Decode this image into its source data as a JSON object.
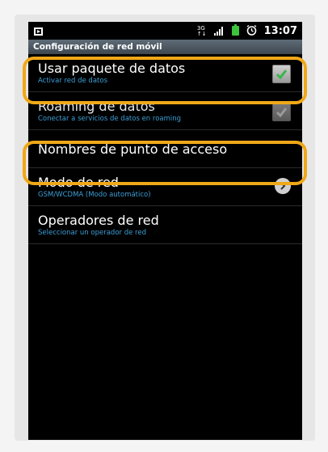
{
  "statusbar": {
    "time": "13:07",
    "network": "3G"
  },
  "title": "Configuración de red móvil",
  "items": [
    {
      "title": "Usar paquete de datos",
      "subtitle": "Activar red de datos",
      "checked": true
    },
    {
      "title": "Roaming de datos",
      "subtitle": "Conectar a servicios de datos en roaming",
      "checked": true
    },
    {
      "title": "Nombres de punto de acceso"
    },
    {
      "title": "Modo de red",
      "subtitle": "GSM/WCDMA (Modo automático)"
    },
    {
      "title": "Operadores de red",
      "subtitle": "Seleccionar un operador de red"
    }
  ],
  "colors": {
    "highlight": "#f0a818",
    "subtitle": "#3d9fd6",
    "check": "#39b54a"
  }
}
